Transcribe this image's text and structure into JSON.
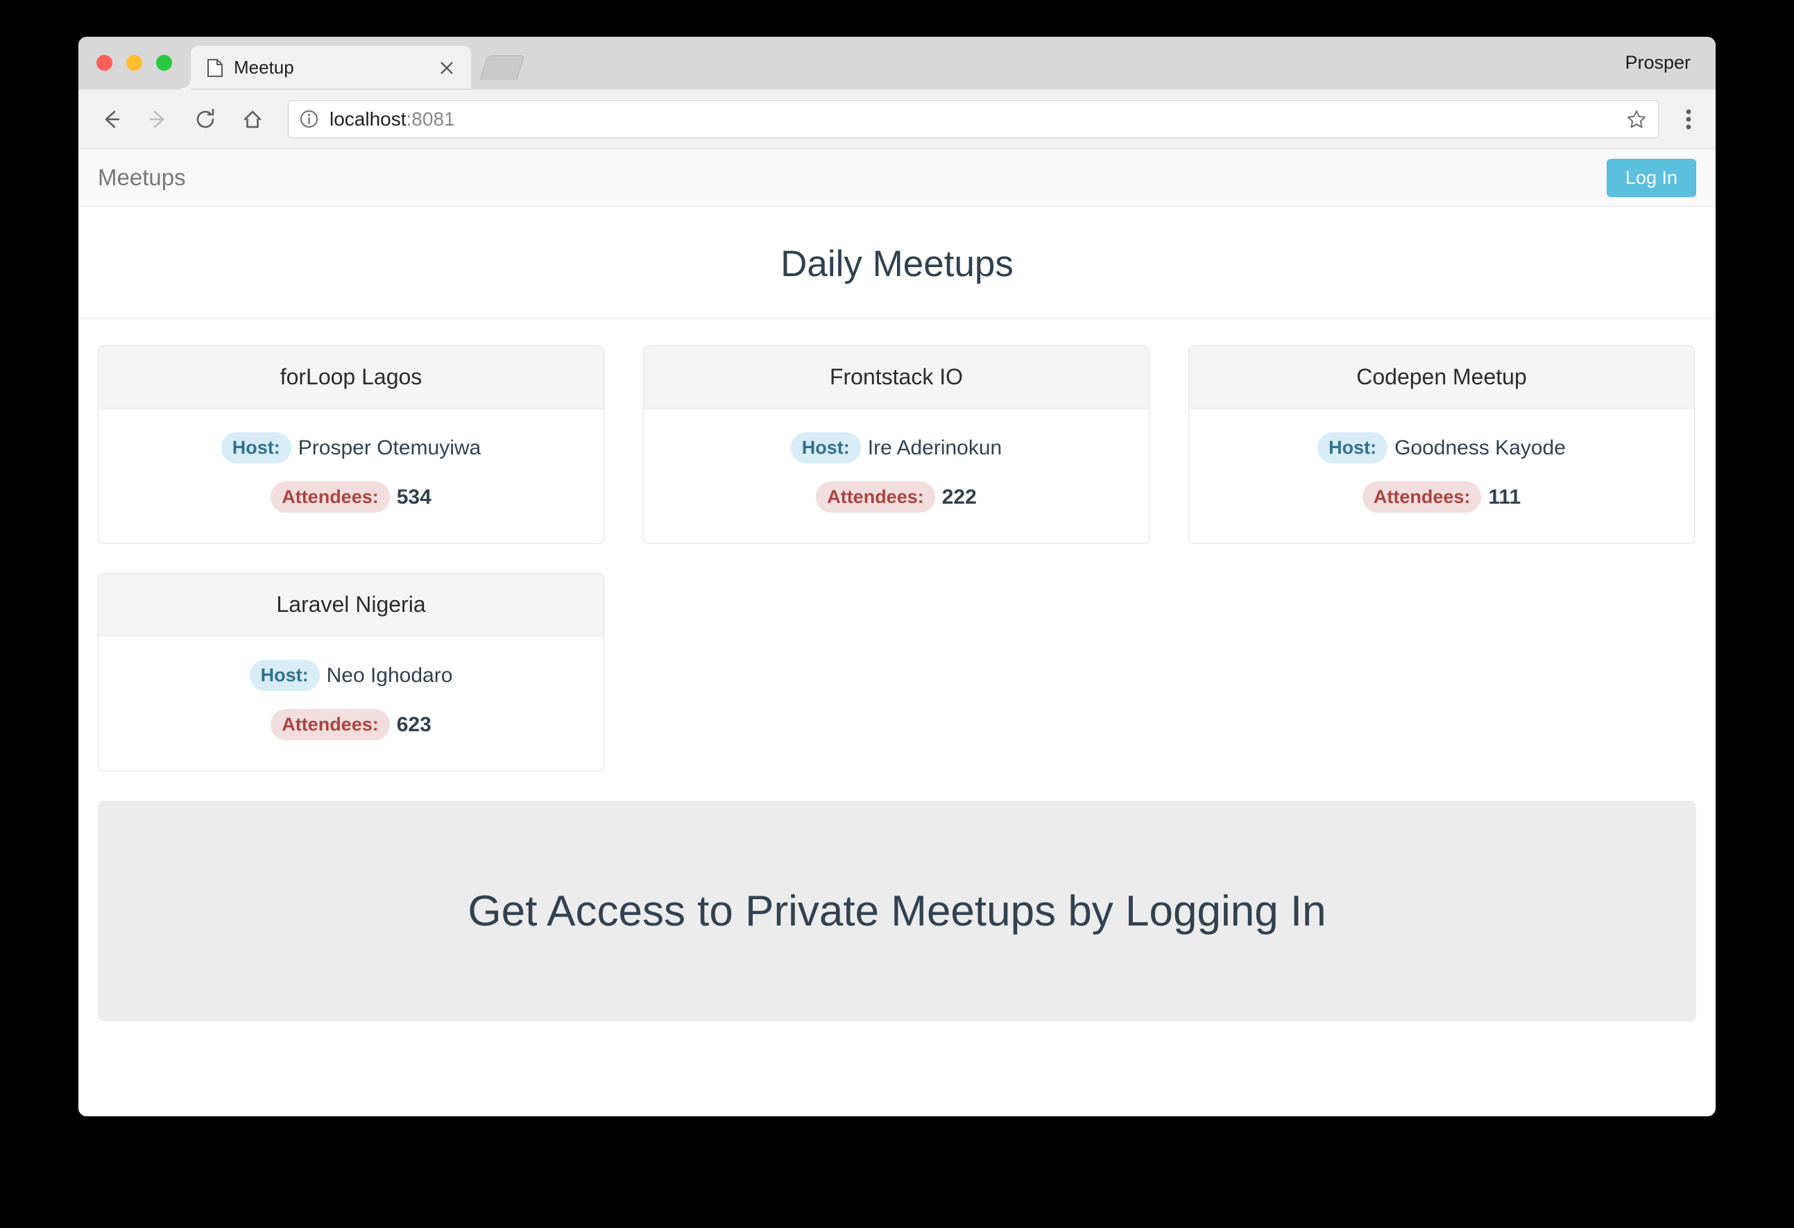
{
  "browser": {
    "profile_name": "Prosper",
    "tab": {
      "title": "Meetup",
      "favicon": "page-icon",
      "close": "close-icon"
    },
    "new_tab_button": "new-tab-icon",
    "toolbar": {
      "back": "back-arrow-icon",
      "forward": "forward-arrow-icon",
      "reload": "reload-icon",
      "home": "home-icon",
      "site_info": "info-icon",
      "url_host": "localhost",
      "url_port": ":8081",
      "bookmark": "star-icon",
      "menu": "three-dots-icon"
    },
    "traffic_lights": {
      "close": "#ff5f57",
      "minimize": "#febc2e",
      "maximize": "#28c840"
    }
  },
  "app": {
    "brand": "Meetups",
    "login_label": "Log In",
    "page_title": "Daily Meetups",
    "jumbotron_text": "Get Access to Private Meetups by Logging In",
    "host_label": "Host:",
    "attendees_label": "Attendees:",
    "meetups": [
      {
        "name": "forLoop Lagos",
        "host": "Prosper Otemuyiwa",
        "attendees": "534"
      },
      {
        "name": "Frontstack IO",
        "host": "Ire Aderinokun",
        "attendees": "222"
      },
      {
        "name": "Codepen Meetup",
        "host": "Goodness Kayode",
        "attendees": "111"
      },
      {
        "name": "Laravel Nigeria",
        "host": "Neo Ighodaro",
        "attendees": "623"
      }
    ]
  },
  "colors": {
    "accent_button": "#5bc0de",
    "heading": "#33404e",
    "host_badge_bg": "#d9edf7",
    "host_badge_text": "#31708f",
    "attendees_badge_bg": "#f2dede",
    "attendees_badge_text": "#a94442",
    "navbar_bg": "#f8f8f8",
    "jumbotron_bg": "#ececec"
  }
}
